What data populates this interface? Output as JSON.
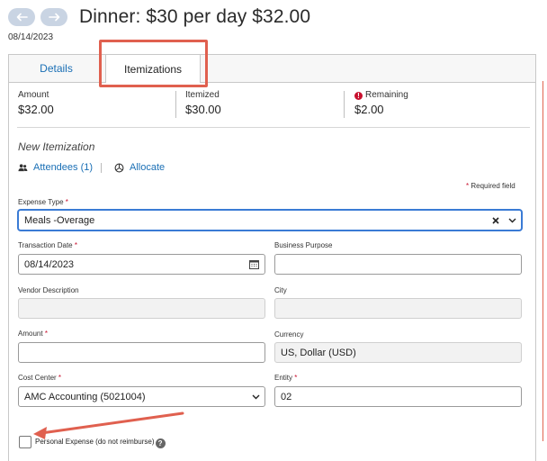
{
  "header": {
    "title": "Dinner: $30 per day $32.00",
    "date": "08/14/2023"
  },
  "tabs": [
    {
      "label": "Details",
      "active": false
    },
    {
      "label": "Itemizations",
      "active": true
    }
  ],
  "summary": {
    "amount_label": "Amount",
    "amount_value": "$32.00",
    "itemized_label": "Itemized",
    "itemized_value": "$30.00",
    "remaining_label": "Remaining",
    "remaining_value": "$2.00"
  },
  "section_title": "New Itemization",
  "links": {
    "attendees": "Attendees (1)",
    "allocate": "Allocate"
  },
  "required_note": "Required field",
  "form": {
    "expense_type": {
      "label": "Expense Type",
      "value": "Meals -Overage"
    },
    "transaction_date": {
      "label": "Transaction Date",
      "value": "08/14/2023"
    },
    "business_purpose": {
      "label": "Business Purpose",
      "value": ""
    },
    "vendor_description": {
      "label": "Vendor Description",
      "value": ""
    },
    "city": {
      "label": "City",
      "value": ""
    },
    "amount": {
      "label": "Amount",
      "value": ""
    },
    "currency": {
      "label": "Currency",
      "value": "US, Dollar (USD)"
    },
    "cost_center": {
      "label": "Cost Center",
      "value": "AMC Accounting (5021004)"
    },
    "entity": {
      "label": "Entity",
      "value": "02"
    },
    "personal_expense": {
      "label": "Personal Expense (do not reimburse)",
      "checked": false
    }
  },
  "colors": {
    "accent": "#1a6fb5",
    "annotation": "#e0604f",
    "required": "#c8102e"
  }
}
